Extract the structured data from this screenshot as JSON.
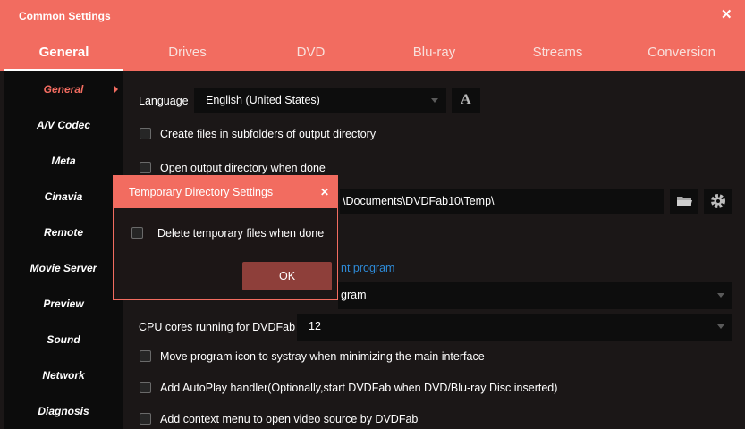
{
  "window": {
    "title": "Common Settings",
    "close_glyph": "✕"
  },
  "tabs": [
    {
      "label": "General"
    },
    {
      "label": "Drives"
    },
    {
      "label": "DVD"
    },
    {
      "label": "Blu-ray"
    },
    {
      "label": "Streams"
    },
    {
      "label": "Conversion"
    }
  ],
  "sidebar": {
    "items": [
      {
        "label": "General"
      },
      {
        "label": "A/V Codec"
      },
      {
        "label": "Meta"
      },
      {
        "label": "Cinavia"
      },
      {
        "label": "Remote"
      },
      {
        "label": "Movie Server"
      },
      {
        "label": "Preview"
      },
      {
        "label": "Sound"
      },
      {
        "label": "Network"
      },
      {
        "label": "Diagnosis"
      }
    ]
  },
  "general": {
    "language_label": "Language",
    "language_value": "English (United States)",
    "font_button_glyph": "A",
    "subfolders_label": "Create files in subfolders of output directory",
    "open_output_label": "Open output directory when done",
    "temp_path": "\\Documents\\DVDFab10\\Temp\\",
    "program_link_partial": "nt program",
    "program_dropdown_partial": "gram",
    "cpu_label": "CPU cores running for DVDFab",
    "cpu_value": "12",
    "systray_label": "Move program icon to systray when minimizing the main interface",
    "autoplay_label": "Add AutoPlay handler(Optionally,start DVDFab when DVD/Blu-ray Disc inserted)",
    "context_menu_label": "Add context menu to open video source by DVDFab"
  },
  "dialog": {
    "title": "Temporary Directory Settings",
    "close_glyph": "✕",
    "delete_label": "Delete temporary files when done",
    "ok_label": "OK"
  },
  "colors": {
    "accent": "#f26c60",
    "background": "#1b1717",
    "sidebar": "#0c0c0c",
    "link": "#2e8bd8"
  }
}
